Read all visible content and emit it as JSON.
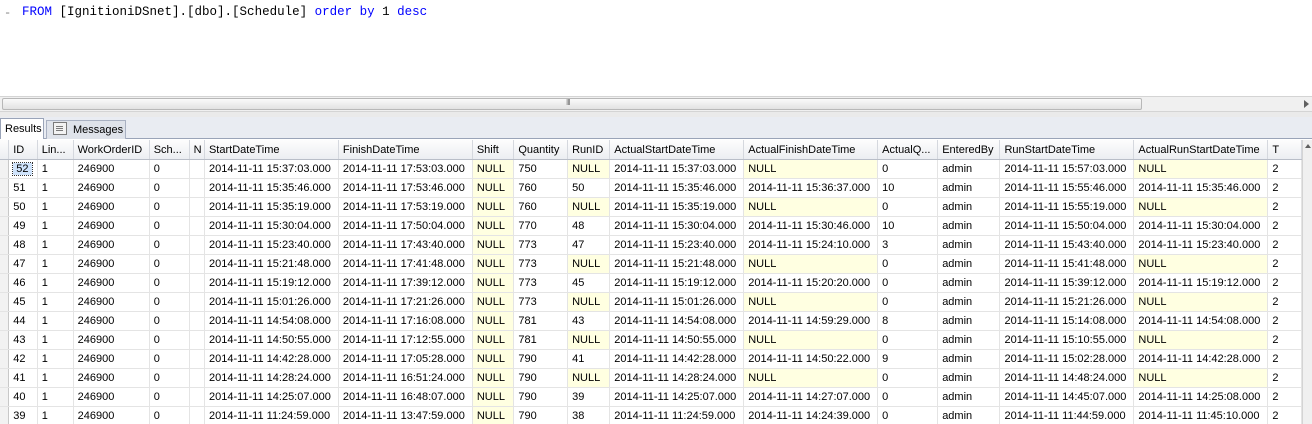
{
  "query": {
    "kw_from": "FROM",
    "table_ref": "[IgnitioniDSnet].[dbo].[Schedule]",
    "kw_order": "order by",
    "order_col": "1",
    "kw_desc": "desc",
    "margin_mark": "-"
  },
  "scroll_grip": "III",
  "tabs": {
    "results": "Results",
    "messages": "Messages"
  },
  "grid": {
    "columns": [
      "ID",
      "Lin...",
      "WorkOrderID",
      "Sch...",
      "N",
      "StartDateTime",
      "FinishDateTime",
      "Shift",
      "Quantity",
      "RunID",
      "ActualStartDateTime",
      "ActualFinishDateTime",
      "ActualQ...",
      "EnteredBy",
      "RunStartDateTime",
      "ActualRunStartDateTime",
      "T"
    ],
    "rows": [
      [
        "52",
        "1",
        "246900",
        "0",
        "",
        "2014-11-11 15:37:03.000",
        "2014-11-11 17:53:03.000",
        "NULL",
        "750",
        "NULL",
        "2014-11-11 15:37:03.000",
        "NULL",
        "0",
        "admin",
        "2014-11-11 15:57:03.000",
        "NULL",
        "2"
      ],
      [
        "51",
        "1",
        "246900",
        "0",
        "",
        "2014-11-11 15:35:46.000",
        "2014-11-11 17:53:46.000",
        "NULL",
        "760",
        "50",
        "2014-11-11 15:35:46.000",
        "2014-11-11 15:36:37.000",
        "10",
        "admin",
        "2014-11-11 15:55:46.000",
        "2014-11-11 15:35:46.000",
        "2"
      ],
      [
        "50",
        "1",
        "246900",
        "0",
        "",
        "2014-11-11 15:35:19.000",
        "2014-11-11 17:53:19.000",
        "NULL",
        "760",
        "NULL",
        "2014-11-11 15:35:19.000",
        "NULL",
        "0",
        "admin",
        "2014-11-11 15:55:19.000",
        "NULL",
        "2"
      ],
      [
        "49",
        "1",
        "246900",
        "0",
        "",
        "2014-11-11 15:30:04.000",
        "2014-11-11 17:50:04.000",
        "NULL",
        "770",
        "48",
        "2014-11-11 15:30:04.000",
        "2014-11-11 15:30:46.000",
        "10",
        "admin",
        "2014-11-11 15:50:04.000",
        "2014-11-11 15:30:04.000",
        "2"
      ],
      [
        "48",
        "1",
        "246900",
        "0",
        "",
        "2014-11-11 15:23:40.000",
        "2014-11-11 17:43:40.000",
        "NULL",
        "773",
        "47",
        "2014-11-11 15:23:40.000",
        "2014-11-11 15:24:10.000",
        "3",
        "admin",
        "2014-11-11 15:43:40.000",
        "2014-11-11 15:23:40.000",
        "2"
      ],
      [
        "47",
        "1",
        "246900",
        "0",
        "",
        "2014-11-11 15:21:48.000",
        "2014-11-11 17:41:48.000",
        "NULL",
        "773",
        "NULL",
        "2014-11-11 15:21:48.000",
        "NULL",
        "0",
        "admin",
        "2014-11-11 15:41:48.000",
        "NULL",
        "2"
      ],
      [
        "46",
        "1",
        "246900",
        "0",
        "",
        "2014-11-11 15:19:12.000",
        "2014-11-11 17:39:12.000",
        "NULL",
        "773",
        "45",
        "2014-11-11 15:19:12.000",
        "2014-11-11 15:20:20.000",
        "0",
        "admin",
        "2014-11-11 15:39:12.000",
        "2014-11-11 15:19:12.000",
        "2"
      ],
      [
        "45",
        "1",
        "246900",
        "0",
        "",
        "2014-11-11 15:01:26.000",
        "2014-11-11 17:21:26.000",
        "NULL",
        "773",
        "NULL",
        "2014-11-11 15:01:26.000",
        "NULL",
        "0",
        "admin",
        "2014-11-11 15:21:26.000",
        "NULL",
        "2"
      ],
      [
        "44",
        "1",
        "246900",
        "0",
        "",
        "2014-11-11 14:54:08.000",
        "2014-11-11 17:16:08.000",
        "NULL",
        "781",
        "43",
        "2014-11-11 14:54:08.000",
        "2014-11-11 14:59:29.000",
        "8",
        "admin",
        "2014-11-11 15:14:08.000",
        "2014-11-11 14:54:08.000",
        "2"
      ],
      [
        "43",
        "1",
        "246900",
        "0",
        "",
        "2014-11-11 14:50:55.000",
        "2014-11-11 17:12:55.000",
        "NULL",
        "781",
        "NULL",
        "2014-11-11 14:50:55.000",
        "NULL",
        "0",
        "admin",
        "2014-11-11 15:10:55.000",
        "NULL",
        "2"
      ],
      [
        "42",
        "1",
        "246900",
        "0",
        "",
        "2014-11-11 14:42:28.000",
        "2014-11-11 17:05:28.000",
        "NULL",
        "790",
        "41",
        "2014-11-11 14:42:28.000",
        "2014-11-11 14:50:22.000",
        "9",
        "admin",
        "2014-11-11 15:02:28.000",
        "2014-11-11 14:42:28.000",
        "2"
      ],
      [
        "41",
        "1",
        "246900",
        "0",
        "",
        "2014-11-11 14:28:24.000",
        "2014-11-11 16:51:24.000",
        "NULL",
        "790",
        "NULL",
        "2014-11-11 14:28:24.000",
        "NULL",
        "0",
        "admin",
        "2014-11-11 14:48:24.000",
        "NULL",
        "2"
      ],
      [
        "40",
        "1",
        "246900",
        "0",
        "",
        "2014-11-11 14:25:07.000",
        "2014-11-11 16:48:07.000",
        "NULL",
        "790",
        "39",
        "2014-11-11 14:25:07.000",
        "2014-11-11 14:27:07.000",
        "0",
        "admin",
        "2014-11-11 14:45:07.000",
        "2014-11-11 14:25:08.000",
        "2"
      ],
      [
        "39",
        "1",
        "246900",
        "0",
        "",
        "2014-11-11 11:24:59.000",
        "2014-11-11 13:47:59.000",
        "NULL",
        "790",
        "38",
        "2014-11-11 11:24:59.000",
        "2014-11-11 14:24:39.000",
        "0",
        "admin",
        "2014-11-11 11:44:59.000",
        "2014-11-11 11:45:10.000",
        "2"
      ]
    ]
  }
}
